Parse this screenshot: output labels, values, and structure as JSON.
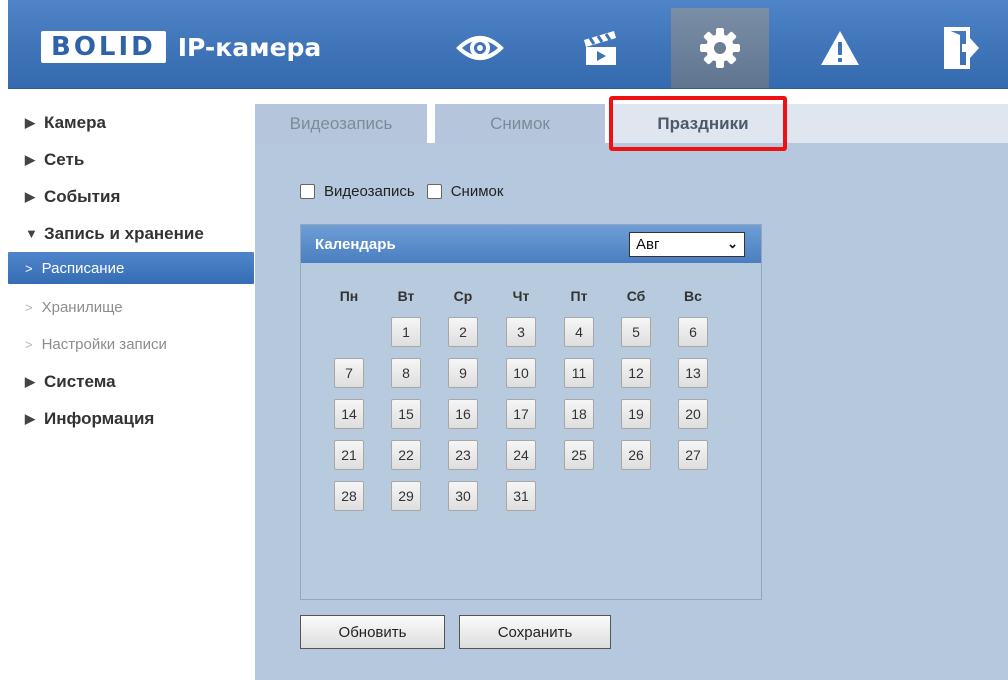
{
  "header": {
    "logo": "BOLID",
    "title": "IP-камера",
    "nav": [
      "view-eye-icon",
      "playback-clapper-icon",
      "settings-gear-icon",
      "alarm-warning-icon",
      "logout-door-icon"
    ],
    "active_nav": "settings-gear-icon"
  },
  "sidebar": {
    "items": [
      {
        "label": "Камера"
      },
      {
        "label": "Сеть"
      },
      {
        "label": "События"
      },
      {
        "label": "Запись и хранение"
      },
      {
        "label": "Система"
      },
      {
        "label": "Информация"
      }
    ],
    "subitems": [
      {
        "label": "Расписание"
      },
      {
        "label": "Хранилище"
      },
      {
        "label": "Настройки записи"
      }
    ]
  },
  "tabs": [
    {
      "label": "Видеозапись"
    },
    {
      "label": "Снимок"
    },
    {
      "label": "Праздники"
    }
  ],
  "active_tab": "Праздники",
  "checks": [
    {
      "label": "Видеозапись",
      "checked": false
    },
    {
      "label": "Снимок",
      "checked": false
    }
  ],
  "calendar": {
    "title": "Календарь",
    "month": "Авг",
    "weekdays": [
      "Пн",
      "Вт",
      "Ср",
      "Чт",
      "Пт",
      "Сб",
      "Вс"
    ],
    "days": [
      "1",
      "2",
      "3",
      "4",
      "5",
      "6",
      "7",
      "8",
      "9",
      "10",
      "11",
      "12",
      "13",
      "14",
      "15",
      "16",
      "17",
      "18",
      "19",
      "20",
      "21",
      "22",
      "23",
      "24",
      "25",
      "26",
      "27",
      "28",
      "29",
      "30",
      "31"
    ]
  },
  "buttons": {
    "refresh": "Обновить",
    "save": "Сохранить"
  },
  "colors": {
    "header": "#3f74b8",
    "content_bg": "#b5c8de",
    "highlight": "#ee1111"
  }
}
